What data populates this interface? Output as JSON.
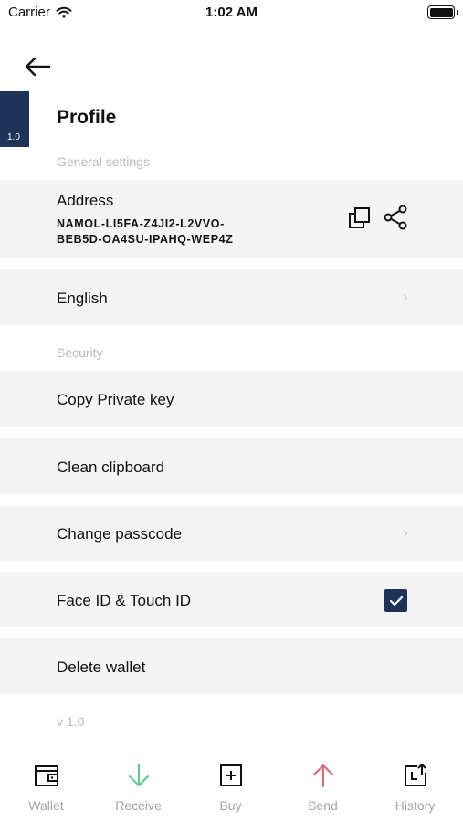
{
  "status_bar": {
    "carrier": "Carrier",
    "time": "1:02 AM"
  },
  "version_tag": "1.0",
  "page_title": "Profile",
  "sections": {
    "general": "General settings",
    "security": "Security"
  },
  "address": {
    "title": "Address",
    "value_line1": "NAMOL-LI5FA-Z4JI2-L2VVO-",
    "value_line2": "BEB5D-OA4SU-IPAHQ-WEP4Z"
  },
  "rows": {
    "language": "English",
    "copy_private_key": "Copy Private key",
    "clean_clipboard": "Clean clipboard",
    "change_passcode": "Change passcode",
    "face_touch_id": "Face ID & Touch ID",
    "delete_wallet": "Delete wallet"
  },
  "face_touch_id_enabled": true,
  "app_version": "v 1.0",
  "tabs": [
    {
      "label": "Wallet",
      "icon": "wallet-icon"
    },
    {
      "label": "Receive",
      "icon": "arrow-down-icon"
    },
    {
      "label": "Buy",
      "icon": "plus-box-icon"
    },
    {
      "label": "Send",
      "icon": "arrow-up-icon"
    },
    {
      "label": "History",
      "icon": "history-icon"
    }
  ],
  "colors": {
    "accent": "#1e3357",
    "receive": "#5dc98a",
    "send": "#e0686d",
    "row_bg": "#f4f4f4",
    "muted": "#b9b9b9"
  }
}
